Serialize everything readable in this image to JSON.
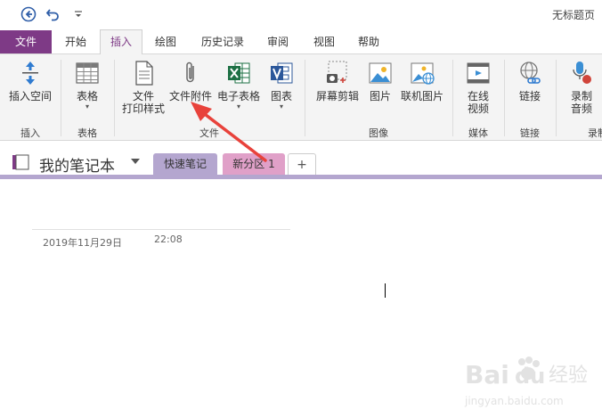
{
  "window": {
    "title": "无标题页"
  },
  "quick_access": {
    "back_icon": "back-circle-icon",
    "undo_icon": "undo-icon",
    "customize_icon": "customize-dropdown-icon"
  },
  "tabs": [
    {
      "label": "文件"
    },
    {
      "label": "开始"
    },
    {
      "label": "插入"
    },
    {
      "label": "绘图"
    },
    {
      "label": "历史记录"
    },
    {
      "label": "审阅"
    },
    {
      "label": "视图"
    },
    {
      "label": "帮助"
    }
  ],
  "ribbon": {
    "insert_space": "插入空间",
    "table": "表格",
    "file_printout": {
      "line1": "文件",
      "line2": "打印样式"
    },
    "file_attachment": "文件附件",
    "spreadsheet": "电子表格",
    "diagram": "图表",
    "screen_clipping": "屏幕剪辑",
    "picture": "图片",
    "online_picture": "联机图片",
    "online_video": {
      "line1": "在线",
      "line2": "视频"
    },
    "link": "链接",
    "record_audio": {
      "line1": "录制",
      "line2": "音频"
    },
    "groups": {
      "insert": "插入",
      "tables": "表格",
      "files": "文件",
      "images": "图像",
      "media": "媒体",
      "links": "链接",
      "recording": "录制"
    }
  },
  "notebook": {
    "name": "我的笔记本",
    "sections": [
      {
        "label": "快速笔记"
      },
      {
        "label": "新分区 1"
      }
    ],
    "add_symbol": "+"
  },
  "page": {
    "date": "2019年11月29日",
    "time": "22:08"
  },
  "colors": {
    "accent": "#7e3a86",
    "section1": "#b4a6cf",
    "section2": "#e0a0c8",
    "arrow": "#e8423b"
  },
  "watermark": {
    "brand": "Bai",
    "brand2": "du",
    "suffix": "经验",
    "url": "jingyan.baidu.com"
  }
}
